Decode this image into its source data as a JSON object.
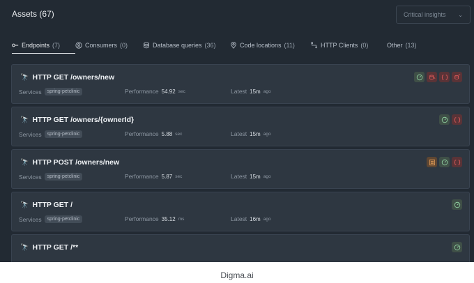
{
  "header": {
    "title": "Assets (67)"
  },
  "insights_select": {
    "value": "Critical insights"
  },
  "tabs": [
    {
      "label": "Endpoints",
      "count": "(7)",
      "icon": "endpoint-icon"
    },
    {
      "label": "Consumers",
      "count": "(0)",
      "icon": "consumer-icon"
    },
    {
      "label": "Database queries",
      "count": "(36)",
      "icon": "database-icon"
    },
    {
      "label": "Code locations",
      "count": "(11)",
      "icon": "location-icon"
    },
    {
      "label": "HTTP Clients",
      "count": "(0)",
      "icon": "http-client-icon"
    },
    {
      "label": "Other",
      "count": "(13)",
      "icon": ""
    }
  ],
  "cards": [
    {
      "title": "HTTP GET /owners/new",
      "services_label": "Services",
      "service": "spring-petclinic",
      "perf_label": "Performance",
      "perf_value": "54.92",
      "perf_unit": "sec",
      "latest_label": "Latest",
      "latest_value": "15m",
      "latest_unit": "ago",
      "badges": [
        "green-gauge",
        "red-db",
        "red-bracket",
        "red-db2"
      ]
    },
    {
      "title": "HTTP GET /owners/{ownerId}",
      "services_label": "Services",
      "service": "spring-petclinic",
      "perf_label": "Performance",
      "perf_value": "5.88",
      "perf_unit": "sec",
      "latest_label": "Latest",
      "latest_value": "15m",
      "latest_unit": "ago",
      "badges": [
        "green-gauge",
        "red-bracket"
      ]
    },
    {
      "title": "HTTP POST /owners/new",
      "services_label": "Services",
      "service": "spring-petclinic",
      "perf_label": "Performance",
      "perf_value": "5.87",
      "perf_unit": "sec",
      "latest_label": "Latest",
      "latest_value": "15m",
      "latest_unit": "ago",
      "badges": [
        "orange-list",
        "green-gauge",
        "red-bracket"
      ]
    },
    {
      "title": "HTTP GET /",
      "services_label": "Services",
      "service": "spring-petclinic",
      "perf_label": "Performance",
      "perf_value": "35.12",
      "perf_unit": "ms",
      "latest_label": "Latest",
      "latest_value": "16m",
      "latest_unit": "ago",
      "badges": [
        "green-gauge"
      ]
    },
    {
      "title": "HTTP GET /**",
      "services_label": "",
      "service": "",
      "perf_label": "",
      "perf_value": "",
      "perf_unit": "",
      "latest_label": "",
      "latest_value": "",
      "latest_unit": "",
      "badges": [
        "green-gauge"
      ]
    }
  ],
  "caption": "Digma.ai",
  "colors": {
    "background": "#222a33",
    "card": "#2e3741",
    "danger": "#e05a5a",
    "success": "#8fcf9f",
    "warning": "#e9a15a"
  }
}
